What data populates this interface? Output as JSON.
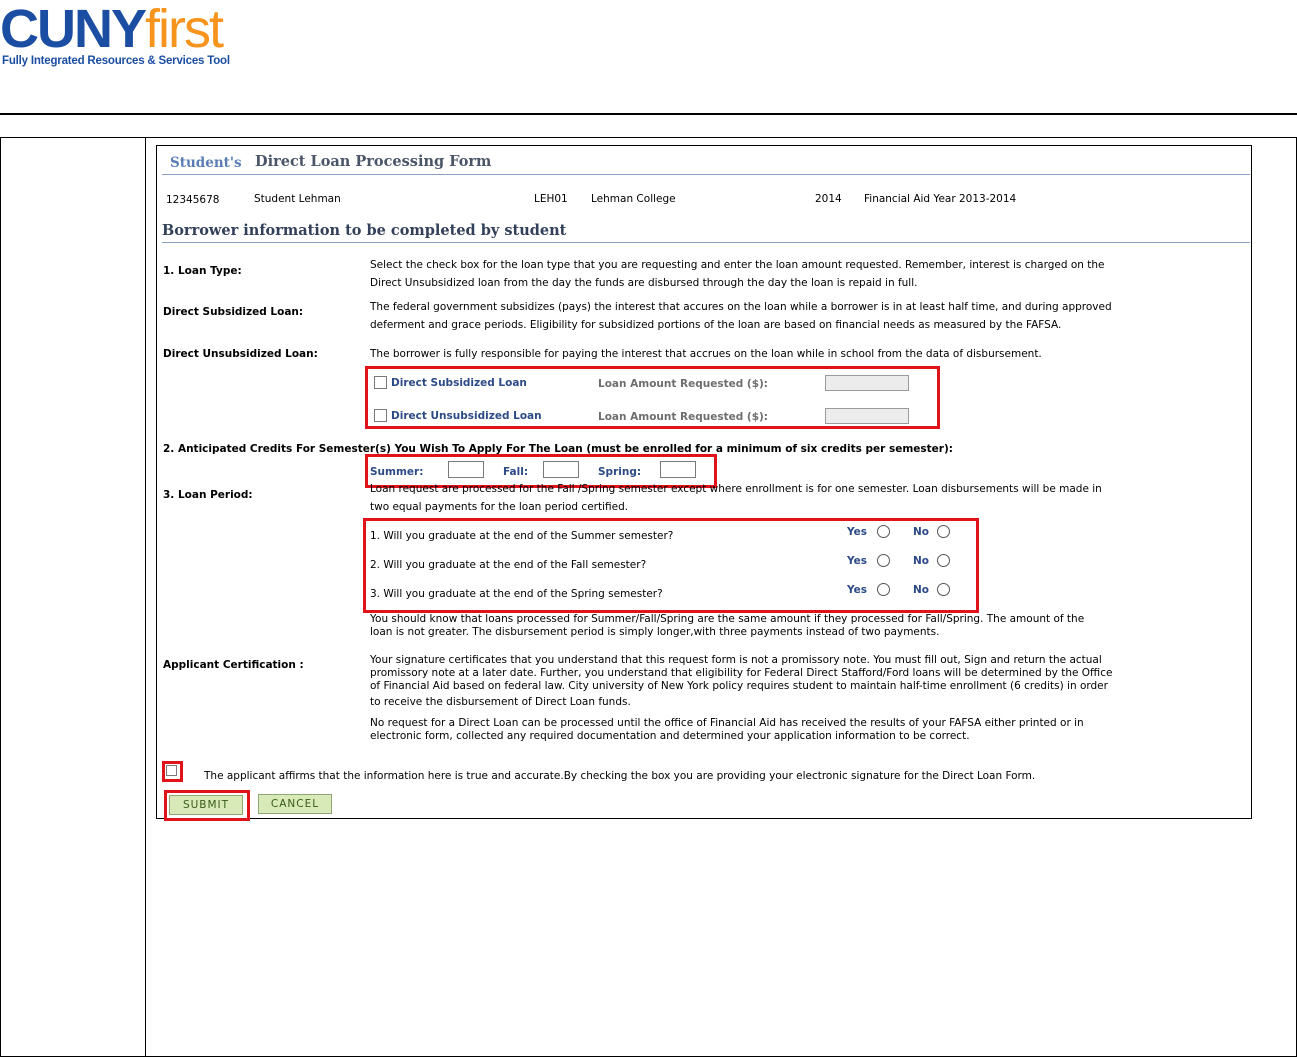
{
  "logo": {
    "brand_a": "CUNY",
    "brand_b": "first",
    "tagline": "Fully Integrated Resources & Services Tool"
  },
  "form": {
    "title_prefix": "Student's",
    "title": "Direct Loan Processing Form",
    "student_id": "12345678",
    "student_name": "Student Lehman",
    "institution_code": "LEH01",
    "institution_name": "Lehman College",
    "aid_year": "2014",
    "aid_year_desc": "Financial Aid Year 2013-2014",
    "section_title": "Borrower information to be completed by student"
  },
  "loan_type": {
    "label": "1. Loan Type:",
    "text_1": "Select the check box for the loan type that you are requesting and enter the loan amount requested. Remember, interest is charged on the",
    "text_2": "Direct Unsubsidized loan from the day the funds are disbursed through the day the loan is repaid in full.",
    "sub_label": "Direct Subsidized Loan:",
    "sub_text_1": "The federal government subsidizes (pays) the interest that accures on the loan while a borrower is in at least half time, and during approved",
    "sub_text_2": "deferment and grace periods. Eligibility for subsidized portions of the loan are based on financial needs as measured by the FAFSA.",
    "unsub_label": "Direct Unsubsidized Loan:",
    "unsub_text": "The borrower is fully responsible for paying the interest that accrues on the loan while in school from the data of disbursement.",
    "option_sub": "Direct Subsidized Loan",
    "option_unsub": "Direct Unsubsidized Loan",
    "amount_label": "Loan Amount Requested ($):",
    "amount_sub": "",
    "amount_unsub": ""
  },
  "credits": {
    "label": "2. Anticipated Credits For Semester(s) You Wish To Apply  For The Loan (must be enrolled for a minimum of six credits  per semester):",
    "summer_label": "Summer:",
    "fall_label": "Fall:",
    "spring_label": "Spring:",
    "summer_value": "",
    "fall_value": "",
    "spring_value": ""
  },
  "loan_period": {
    "label": "3. Loan Period:",
    "text_1": "Loan request are processed for the Fall /Spring semester except where enrollment is for one semester. Loan disbursements will be made in",
    "text_2": "two equal payments for the loan period certified.",
    "questions": [
      "1. Will you graduate at the end of the Summer semester?",
      "2. Will you graduate at the end of the Fall semester?",
      "3. Will you graduate at the end of the Spring semester?"
    ],
    "yes": "Yes",
    "no": "No",
    "note_1": "You should know that loans processed for Summer/Fall/Spring are the same amount if they processed for Fall/Spring. The amount of the",
    "note_2": "loan is not greater. The disbursement period is simply longer,with three payments instead of two payments."
  },
  "certification": {
    "label": "Applicant Certification :",
    "text_1": "Your signature certificates that you understand that this request form is not a promissory note. You must fill out, Sign and return the actual",
    "text_2": "promissory note at a later date. Further, you understand that eligibility for Federal Direct Stafford/Ford loans will be determined by the Office",
    "text_3": "of Financial Aid based on federal law. City university of New York policy requires student to maintain half-time enrollment (6 credits) in order",
    "text_4": "to receive the disbursement of Direct Loan funds.",
    "text_5": "No request for a Direct Loan can be processed until the office of Financial Aid has received the results of your FAFSA either printed or in",
    "text_6": "electronic form, collected any required documentation and determined your application information to be correct.",
    "affirm": "The applicant affirms that the information here is true and accurate.By checking the box you are providing your electronic signature for the Direct Loan Form."
  },
  "buttons": {
    "submit": "Submit",
    "cancel": "Cancel"
  },
  "colors": {
    "highlight": "#e0131b",
    "button_bg": "#d7eab8",
    "brand_blue": "#1b4ea3",
    "brand_orange": "#f7941e"
  }
}
